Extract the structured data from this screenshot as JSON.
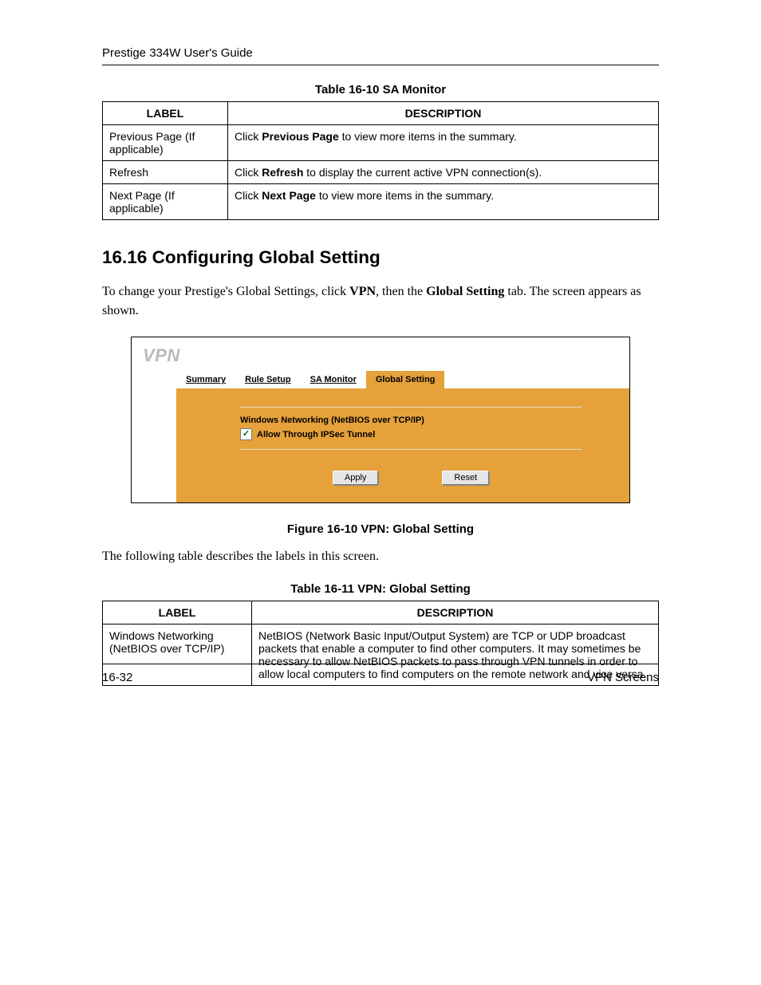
{
  "header": {
    "title": "Prestige 334W User's Guide"
  },
  "table1": {
    "caption": "Table 16-10 SA Monitor",
    "headers": {
      "label": "LABEL",
      "description": "DESCRIPTION"
    },
    "rows": [
      {
        "label": "Previous Page (If applicable)",
        "desc_pre": "Click ",
        "desc_bold": "Previous Page",
        "desc_post": " to view more items in the summary."
      },
      {
        "label": "Refresh",
        "desc_pre": "Click ",
        "desc_bold": "Refresh",
        "desc_post": " to display the current active VPN connection(s)."
      },
      {
        "label": "Next Page (If applicable)",
        "desc_pre": "Click ",
        "desc_bold": "Next Page",
        "desc_post": " to view more items in the summary."
      }
    ]
  },
  "section": {
    "number": "16.16",
    "title": "Configuring Global Setting"
  },
  "intro": {
    "pre": "To change your Prestige's Global Settings, click ",
    "bold1": "VPN",
    "mid": ", then the ",
    "bold2": "Global Setting",
    "post": " tab. The screen appears as shown."
  },
  "figure": {
    "title": "VPN",
    "tabs": [
      "Summary",
      "Rule Setup",
      "SA Monitor",
      "Global Setting"
    ],
    "active_tab_index": 3,
    "section_label": "Windows Networking (NetBIOS over TCP/IP)",
    "checkbox_label": "Allow Through IPSec Tunnel",
    "checkbox_checked": true,
    "buttons": {
      "apply": "Apply",
      "reset": "Reset"
    },
    "caption": "Figure 16-10 VPN: Global Setting"
  },
  "after_figure": "The following table describes the labels in this screen.",
  "table2": {
    "caption": "Table 16-11 VPN: Global Setting",
    "headers": {
      "label": "LABEL",
      "description": "DESCRIPTION"
    },
    "rows": [
      {
        "label": "Windows Networking (NetBIOS over TCP/IP)",
        "description": "NetBIOS (Network Basic Input/Output System) are TCP or UDP broadcast packets that enable a computer to find other computers. It may sometimes be necessary to allow NetBIOS packets to pass through VPN tunnels in order to allow local computers to find computers on the remote network and vice versa."
      }
    ]
  },
  "footer": {
    "page_number": "16-32",
    "section_name": "VPN Screens"
  }
}
